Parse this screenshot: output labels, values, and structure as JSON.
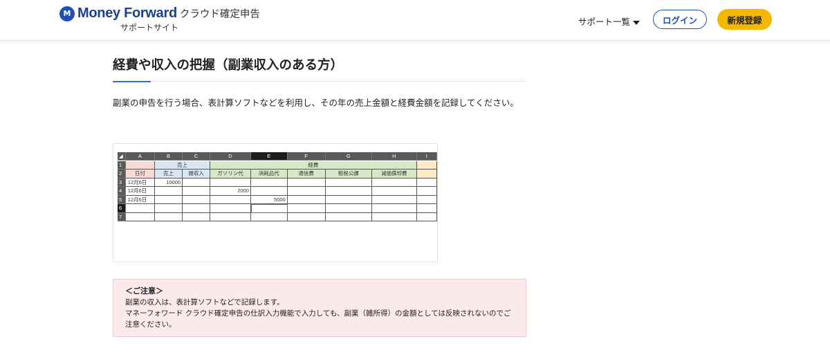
{
  "header": {
    "logo_mark": "M",
    "brand": "Money Forward",
    "product": "クラウド確定申告",
    "subtitle": "サポートサイト",
    "support_menu": "サポート一覧",
    "login": "ログイン",
    "register": "新規登録",
    "colors": {
      "brand": "#1f4fb3",
      "register_bg": "#f5b800"
    }
  },
  "article": {
    "title": "経費や収入の把握（副業収入のある方）",
    "body": "副業の申告を行う場合、表計算ソフトなどを利用し、その年の売上金額と経費金額を記録してください。",
    "spreadsheet": {
      "columns": [
        "A",
        "B",
        "C",
        "D",
        "E",
        "F",
        "G",
        "H",
        "I"
      ],
      "row_numbers": [
        "1",
        "2",
        "3",
        "4",
        "5",
        "6",
        "7"
      ],
      "group_sales": "売上",
      "group_expenses": "経費",
      "headers": [
        "日付",
        "売上",
        "雑収入",
        "ガソリン代",
        "消耗品代",
        "通信費",
        "租税公課",
        "減価償却費",
        ""
      ],
      "rows": [
        [
          "12月6日",
          "10000",
          "",
          "",
          "",
          "",
          "",
          "",
          ""
        ],
        [
          "12月6日",
          "",
          "",
          "2000",
          "",
          "",
          "",
          "",
          ""
        ],
        [
          "12月6日",
          "",
          "",
          "",
          "5000",
          "",
          "",
          "",
          ""
        ],
        [
          "",
          "",
          "",
          "",
          "",
          "",
          "",
          "",
          ""
        ],
        [
          "",
          "",
          "",
          "",
          "",
          "",
          "",
          "",
          ""
        ]
      ]
    },
    "note": {
      "title": "＜ご注意＞",
      "line1": "副業の収入は、表計算ソフトなどで記録します。",
      "line2": "マネーフォワード クラウド確定申告の仕訳入力機能で入力しても、副業（雑所得）の金額としては反映されないのでご注意ください。"
    }
  }
}
